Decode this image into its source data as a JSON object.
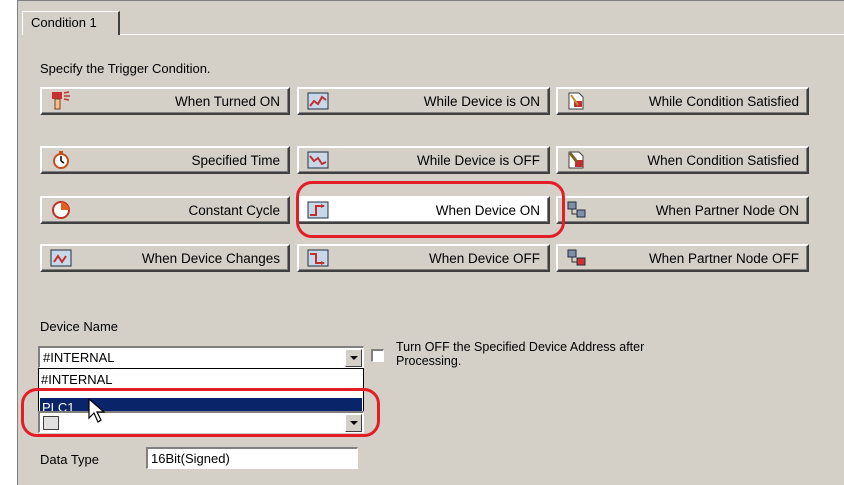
{
  "tab": {
    "label": "Condition 1"
  },
  "instruction": "Specify the Trigger Condition.",
  "buttons": [
    {
      "label": "When Turned ON",
      "icon": "hand-press-icon"
    },
    {
      "label": "While Device is ON",
      "icon": "device-on-icon"
    },
    {
      "label": "While Condition Satisfied",
      "icon": "condition-satisfied-icon"
    },
    {
      "label": "Specified Time",
      "icon": "timer-icon"
    },
    {
      "label": "While Device is OFF",
      "icon": "device-off-icon"
    },
    {
      "label": "When Condition Satisfied",
      "icon": "condition-ok-icon"
    },
    {
      "label": "Constant Cycle",
      "icon": "cycle-clock-icon"
    },
    {
      "label": "When Device ON",
      "icon": "device-rise-icon",
      "selected": true
    },
    {
      "label": "When Partner Node ON",
      "icon": "partner-node-on-icon"
    },
    {
      "label": "When Device Changes",
      "icon": "device-change-icon"
    },
    {
      "label": "When Device OFF",
      "icon": "device-fall-icon"
    },
    {
      "label": "When Partner Node OFF",
      "icon": "partner-node-off-icon"
    }
  ],
  "device": {
    "label": "Device Name",
    "value": "#INTERNAL",
    "options": [
      "#INTERNAL",
      "PLC1"
    ],
    "highlighted": "PLC1"
  },
  "turnoff": {
    "label_line1": "Turn OFF the Specified Device Address after",
    "label_line2": "Processing.",
    "checked": false
  },
  "datatype": {
    "label": "Data Type",
    "value": "16Bit(Signed)"
  },
  "colors": {
    "panel": "#d4d0c8",
    "highlight": "#0a246a",
    "annotation": "#e41e26"
  }
}
